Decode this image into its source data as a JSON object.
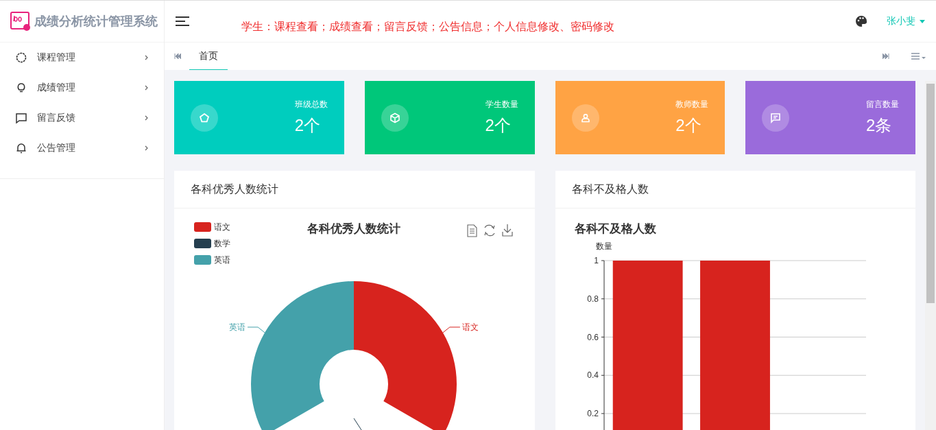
{
  "sidebar": {
    "logo_text": "成绩分析统计管理系统",
    "items": [
      {
        "label": "课程管理"
      },
      {
        "label": "成绩管理"
      },
      {
        "label": "留言反馈"
      },
      {
        "label": "公告管理"
      }
    ]
  },
  "header": {
    "notice": "学生：课程查看；成绩查看；留言反馈；公告信息；个人信息修改、密码修改",
    "user": "张小斐"
  },
  "tabs": [
    {
      "label": "首页",
      "selected": true
    }
  ],
  "stats": [
    {
      "label": "班级总数",
      "value": "2个",
      "color": "#00cdbe"
    },
    {
      "label": "学生数量",
      "value": "2个",
      "color": "#00c77a"
    },
    {
      "label": "教师数量",
      "value": "2个",
      "color": "#ffa344"
    },
    {
      "label": "留言数量",
      "value": "2条",
      "color": "#9a6bdb"
    }
  ],
  "panels": [
    {
      "title": "各科优秀人数统计",
      "kind": "donut",
      "chart_title": "各科优秀人数统计",
      "legend": [
        {
          "label": "语文",
          "color": "#d7231e"
        },
        {
          "label": "数学",
          "color": "#253f4f"
        },
        {
          "label": "英语",
          "color": "#44a1aa"
        }
      ],
      "slice_labels": [
        "英语",
        "语文"
      ]
    },
    {
      "title": "各科不及格人数",
      "chart_data": {
        "type": "bar",
        "title": "各科不及格人数",
        "ylabel": "数量",
        "ylim": [
          0,
          1
        ],
        "grid": true,
        "yticks": [
          0.2,
          0.4,
          0.6,
          0.8,
          1
        ],
        "series": [
          {
            "color": "#d7231e",
            "values": [
              1,
              1,
              null
            ]
          }
        ]
      }
    }
  ]
}
